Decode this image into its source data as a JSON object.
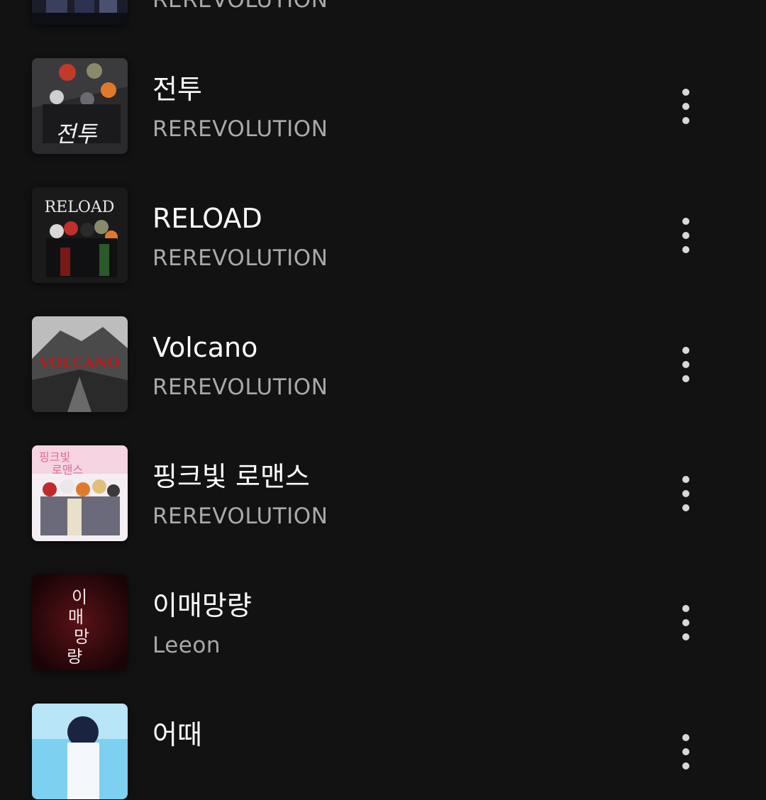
{
  "tracks": [
    {
      "title": "",
      "artist": "REREVOLUTION",
      "cover_icon": "album-cover"
    },
    {
      "title": "전투",
      "artist": "REREVOLUTION",
      "cover_icon": "album-cover"
    },
    {
      "title": "RELOAD",
      "artist": "REREVOLUTION",
      "cover_icon": "album-cover"
    },
    {
      "title": "Volcano",
      "artist": "REREVOLUTION",
      "cover_icon": "album-cover"
    },
    {
      "title": "핑크빛 로맨스",
      "artist": "REREVOLUTION",
      "cover_icon": "album-cover"
    },
    {
      "title": "이매망량",
      "artist": "Leeon",
      "cover_icon": "album-cover"
    },
    {
      "title": "어때",
      "artist": "",
      "cover_icon": "album-cover"
    }
  ],
  "colors": {
    "background": "#121212",
    "title": "#ffffff",
    "artist": "#a9a9a9",
    "menu_dots": "#d8d8d8"
  }
}
